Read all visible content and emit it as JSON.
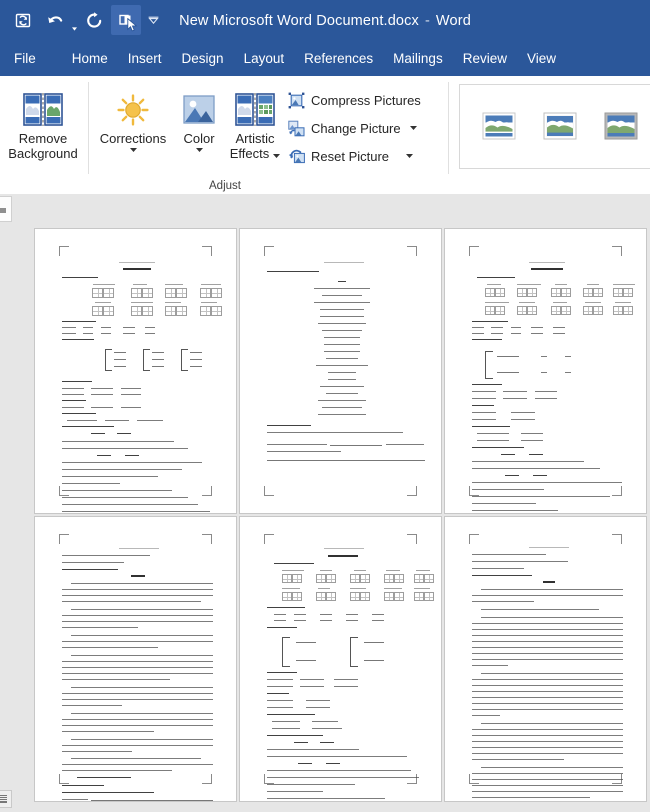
{
  "window": {
    "title": "New Microsoft Word Document.docx",
    "separator": "-",
    "app_name": "Word",
    "accent_color": "#2b579a"
  },
  "quick_access": {
    "items": [
      {
        "name": "save-icon",
        "label": "Save",
        "active": false
      },
      {
        "name": "undo-icon",
        "label": "Undo",
        "active": false
      },
      {
        "name": "redo-icon",
        "label": "Redo",
        "active": false
      },
      {
        "name": "duplicate-icon",
        "label": "Repeat",
        "active": true
      }
    ],
    "customize_label": "Customize Quick Access Toolbar"
  },
  "ribbon": {
    "tabs": [
      {
        "label": "File",
        "selected": false
      },
      {
        "label": "Home",
        "selected": false
      },
      {
        "label": "Insert",
        "selected": false
      },
      {
        "label": "Design",
        "selected": false
      },
      {
        "label": "Layout",
        "selected": false
      },
      {
        "label": "References",
        "selected": false
      },
      {
        "label": "Mailings",
        "selected": false
      },
      {
        "label": "Review",
        "selected": false
      },
      {
        "label": "View",
        "selected": false
      }
    ],
    "groups": [
      {
        "name": "adjust",
        "label": "Adjust",
        "big_buttons": [
          {
            "name": "remove-background",
            "line1": "Remove",
            "line2": "Background",
            "has_caret": false
          },
          {
            "name": "corrections",
            "line1": "Corrections",
            "line2": "",
            "has_caret": true
          },
          {
            "name": "color",
            "line1": "Color",
            "line2": "",
            "has_caret": true
          },
          {
            "name": "artistic-effects",
            "line1": "Artistic",
            "line2": "Effects",
            "has_caret": true
          }
        ],
        "small_buttons": [
          {
            "name": "compress-pictures",
            "label": "Compress Pictures",
            "has_caret": false
          },
          {
            "name": "change-picture",
            "label": "Change Picture",
            "has_caret": true
          },
          {
            "name": "reset-picture",
            "label": "Reset Picture",
            "has_caret": true
          }
        ]
      },
      {
        "name": "picture-styles",
        "label": "",
        "gallery_items": [
          {
            "name": "picture-style-simple-frame-white"
          },
          {
            "name": "picture-style-beveled-matte-white"
          },
          {
            "name": "picture-style-metal-frame"
          }
        ]
      }
    ]
  },
  "document": {
    "zoom_view": "multi-page",
    "page_count_visible": 6,
    "pages": [
      {
        "number": 1,
        "layout": "worksheet-grid",
        "header": "true",
        "title": "true"
      },
      {
        "number": 2,
        "layout": "centered-poem",
        "header": "true",
        "title": "false"
      },
      {
        "number": 3,
        "layout": "worksheet-grid",
        "header": "true",
        "title": "true"
      },
      {
        "number": 4,
        "layout": "dense-prose",
        "header": "true",
        "title": "false"
      },
      {
        "number": 5,
        "layout": "worksheet-grid",
        "header": "true",
        "title": "true"
      },
      {
        "number": 6,
        "layout": "dense-prose",
        "header": "true",
        "title": "false"
      }
    ]
  },
  "colors": {
    "ribbon_bg": "#ffffff",
    "workspace_bg": "#e6e6e6",
    "page_bg": "#ffffff",
    "page_border": "#c7c7c7"
  }
}
